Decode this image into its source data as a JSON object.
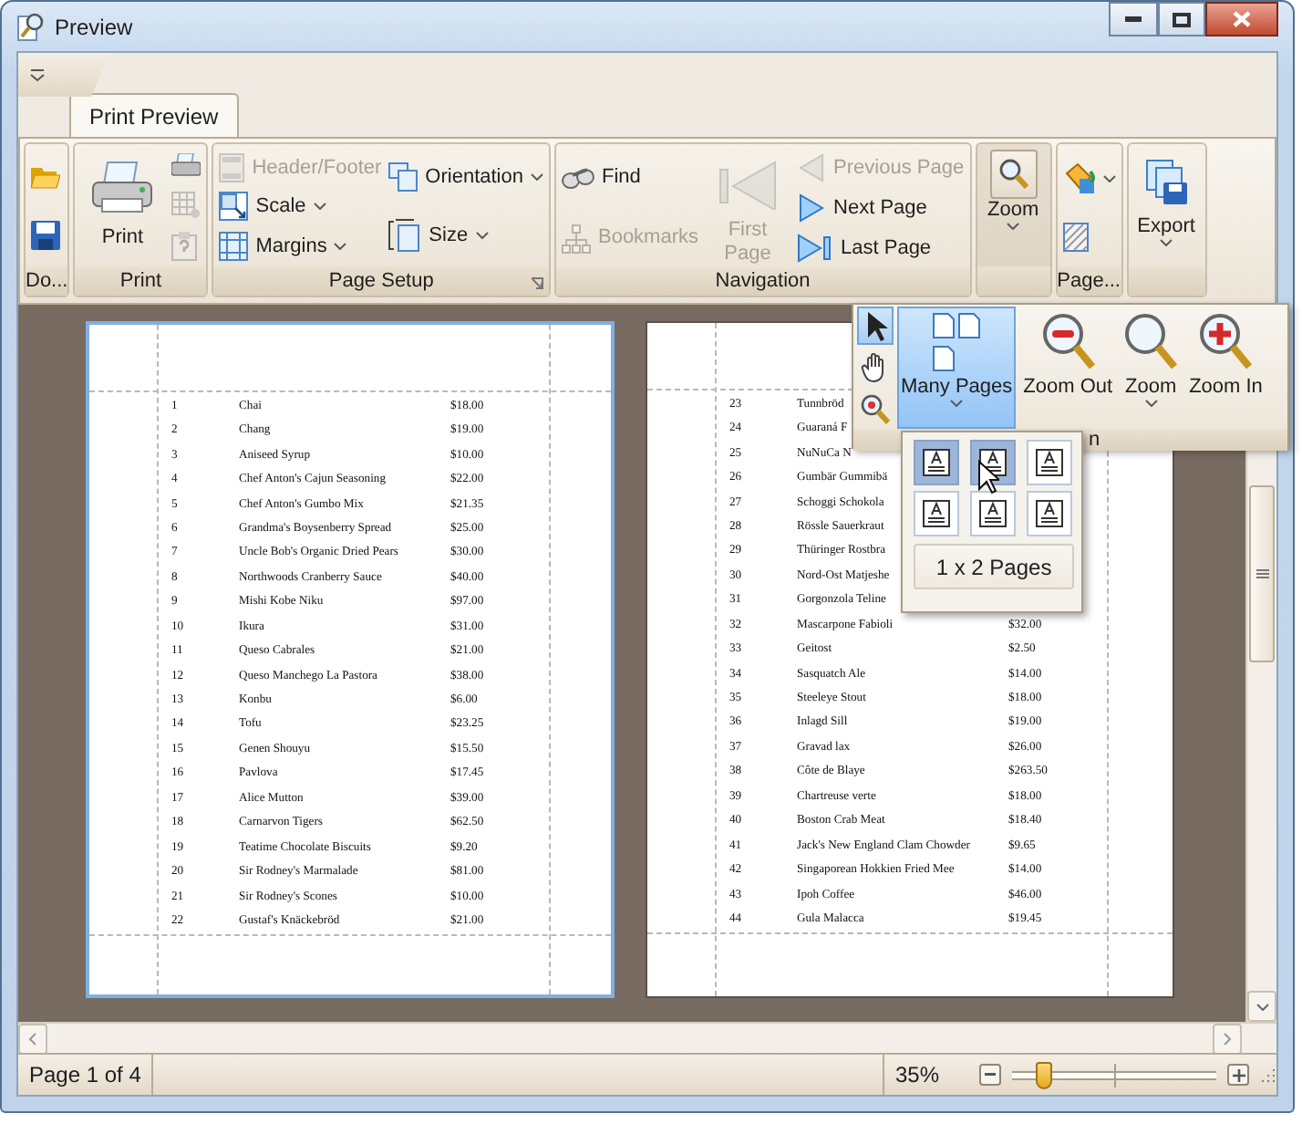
{
  "window": {
    "title": "Preview"
  },
  "tabs": [
    {
      "label": "Print Preview",
      "selected": true
    }
  ],
  "ribbon_groups": [
    {
      "caption": "Do...",
      "items": [
        {
          "kind": "icon",
          "disabled": false
        },
        {
          "kind": "icon",
          "disabled": false
        }
      ]
    },
    {
      "caption": "Print",
      "items": [
        {
          "kind": "large",
          "label": "Print",
          "disabled": false
        },
        {
          "kind": "icon",
          "disabled": false
        },
        {
          "kind": "icon",
          "disabled": true
        },
        {
          "kind": "icon",
          "disabled": true
        }
      ]
    },
    {
      "caption": "Page Setup",
      "launcher": true,
      "items": [
        {
          "kind": "small",
          "label": "Header/Footer",
          "disabled": true
        },
        {
          "kind": "small",
          "label": "Scale",
          "disabled": false,
          "dropdown": true
        },
        {
          "kind": "small",
          "label": "Margins",
          "disabled": false,
          "dropdown": true
        },
        {
          "kind": "small",
          "label": "Orientation",
          "disabled": false,
          "dropdown": true
        },
        {
          "kind": "small",
          "label": "Size",
          "disabled": false,
          "dropdown": true
        }
      ]
    },
    {
      "caption": "Navigation",
      "items": [
        {
          "kind": "small",
          "label": "Find",
          "disabled": false
        },
        {
          "kind": "small",
          "label": "Bookmarks",
          "disabled": true
        },
        {
          "kind": "large",
          "label": "First Page",
          "disabled": true
        },
        {
          "kind": "small",
          "label": "Previous Page",
          "disabled": true
        },
        {
          "kind": "small",
          "label": "Next Page",
          "disabled": false
        },
        {
          "kind": "small",
          "label": "Last Page",
          "disabled": false
        }
      ]
    },
    {
      "items": [
        {
          "kind": "large",
          "label": "Zoom",
          "disabled": false,
          "dropdown": true,
          "expanded": true
        }
      ]
    },
    {
      "caption": "Page...",
      "items": [
        {
          "kind": "icon",
          "disabled": false,
          "dropdown": true
        },
        {
          "kind": "icon",
          "disabled": false
        }
      ]
    },
    {
      "items": [
        {
          "kind": "large",
          "label": "Export",
          "disabled": false,
          "dropdown": true,
          "expanded": false
        }
      ]
    }
  ],
  "zoom_popup": {
    "tools": [
      {
        "selected": true
      },
      {
        "selected": false
      },
      {
        "selected": false
      }
    ],
    "buttons": [
      {
        "label": "Many Pages",
        "dropdown": true,
        "expanded": true
      },
      {
        "label": "Zoom Out",
        "dropdown": false,
        "expanded": false
      },
      {
        "label": "Zoom",
        "dropdown": true,
        "expanded": false
      },
      {
        "label": "Zoom In",
        "dropdown": false,
        "expanded": false
      }
    ],
    "caption": "n"
  },
  "many_pages": {
    "rows": [
      {
        "cells": [
          {
            "selected": true
          },
          {
            "selected": true
          },
          {
            "selected": false
          }
        ]
      },
      {
        "cells": [
          {
            "selected": false
          },
          {
            "selected": false
          },
          {
            "selected": false
          }
        ]
      }
    ],
    "caption": "1 x 2 Pages"
  },
  "pages": [
    {
      "selected": true,
      "rows": [
        {
          "number": "1",
          "name": "Chai",
          "price": "$18.00"
        },
        {
          "number": "2",
          "name": "Chang",
          "price": "$19.00"
        },
        {
          "number": "3",
          "name": "Aniseed Syrup",
          "price": "$10.00"
        },
        {
          "number": "4",
          "name": "Chef Anton's Cajun Seasoning",
          "price": "$22.00"
        },
        {
          "number": "5",
          "name": "Chef Anton's Gumbo Mix",
          "price": "$21.35"
        },
        {
          "number": "6",
          "name": "Grandma's Boysenberry Spread",
          "price": "$25.00"
        },
        {
          "number": "7",
          "name": "Uncle Bob's Organic Dried Pears",
          "price": "$30.00"
        },
        {
          "number": "8",
          "name": "Northwoods Cranberry Sauce",
          "price": "$40.00"
        },
        {
          "number": "9",
          "name": "Mishi Kobe Niku",
          "price": "$97.00"
        },
        {
          "number": "10",
          "name": "Ikura",
          "price": "$31.00"
        },
        {
          "number": "11",
          "name": "Queso Cabrales",
          "price": "$21.00"
        },
        {
          "number": "12",
          "name": "Queso Manchego La Pastora",
          "price": "$38.00"
        },
        {
          "number": "13",
          "name": "Konbu",
          "price": "$6.00"
        },
        {
          "number": "14",
          "name": "Tofu",
          "price": "$23.25"
        },
        {
          "number": "15",
          "name": "Genen Shouyu",
          "price": "$15.50"
        },
        {
          "number": "16",
          "name": "Pavlova",
          "price": "$17.45"
        },
        {
          "number": "17",
          "name": "Alice Mutton",
          "price": "$39.00"
        },
        {
          "number": "18",
          "name": "Carnarvon Tigers",
          "price": "$62.50"
        },
        {
          "number": "19",
          "name": "Teatime Chocolate Biscuits",
          "price": "$9.20"
        },
        {
          "number": "20",
          "name": "Sir Rodney's Marmalade",
          "price": "$81.00"
        },
        {
          "number": "21",
          "name": "Sir Rodney's Scones",
          "price": "$10.00"
        },
        {
          "number": "22",
          "name": "Gustaf's Knäckebröd",
          "price": "$21.00"
        }
      ]
    },
    {
      "selected": false,
      "rows": [
        {
          "number": "23",
          "name": "Tunnbröd"
        },
        {
          "number": "24",
          "name": "Guaraná F"
        },
        {
          "number": "25",
          "name": "NuNuCa N"
        },
        {
          "number": "26",
          "name": "Gumbär Gummibä"
        },
        {
          "number": "27",
          "name": "Schoggi Schokola"
        },
        {
          "number": "28",
          "name": "Rössle Sauerkraut"
        },
        {
          "number": "29",
          "name": "Thüringer Rostbra"
        },
        {
          "number": "30",
          "name": "Nord-Ost Matjeshe"
        },
        {
          "number": "31",
          "name": "Gorgonzola Teline"
        },
        {
          "number": "32",
          "name": "Mascarpone Fabioli",
          "price": "$32.00"
        },
        {
          "number": "33",
          "name": "Geitost",
          "price": "$2.50"
        },
        {
          "number": "34",
          "name": "Sasquatch Ale",
          "price": "$14.00"
        },
        {
          "number": "35",
          "name": "Steeleye Stout",
          "price": "$18.00"
        },
        {
          "number": "36",
          "name": "Inlagd Sill",
          "price": "$19.00"
        },
        {
          "number": "37",
          "name": "Gravad lax",
          "price": "$26.00"
        },
        {
          "number": "38",
          "name": "Côte de Blaye",
          "price": "$263.50"
        },
        {
          "number": "39",
          "name": "Chartreuse verte",
          "price": "$18.00"
        },
        {
          "number": "40",
          "name": "Boston Crab Meat",
          "price": "$18.40"
        },
        {
          "number": "41",
          "name": "Jack's New England Clam Chowder",
          "price": "$9.65"
        },
        {
          "number": "42",
          "name": "Singaporean Hokkien Fried Mee",
          "price": "$14.00"
        },
        {
          "number": "43",
          "name": "Ipoh Coffee",
          "price": "$46.00"
        },
        {
          "number": "44",
          "name": "Gula Malacca",
          "price": "$19.45"
        }
      ]
    }
  ],
  "status_bar": {
    "page": "Page 1 of 4",
    "zoom": "35%",
    "zoom_slider": {
      "level": 0.15
    }
  }
}
